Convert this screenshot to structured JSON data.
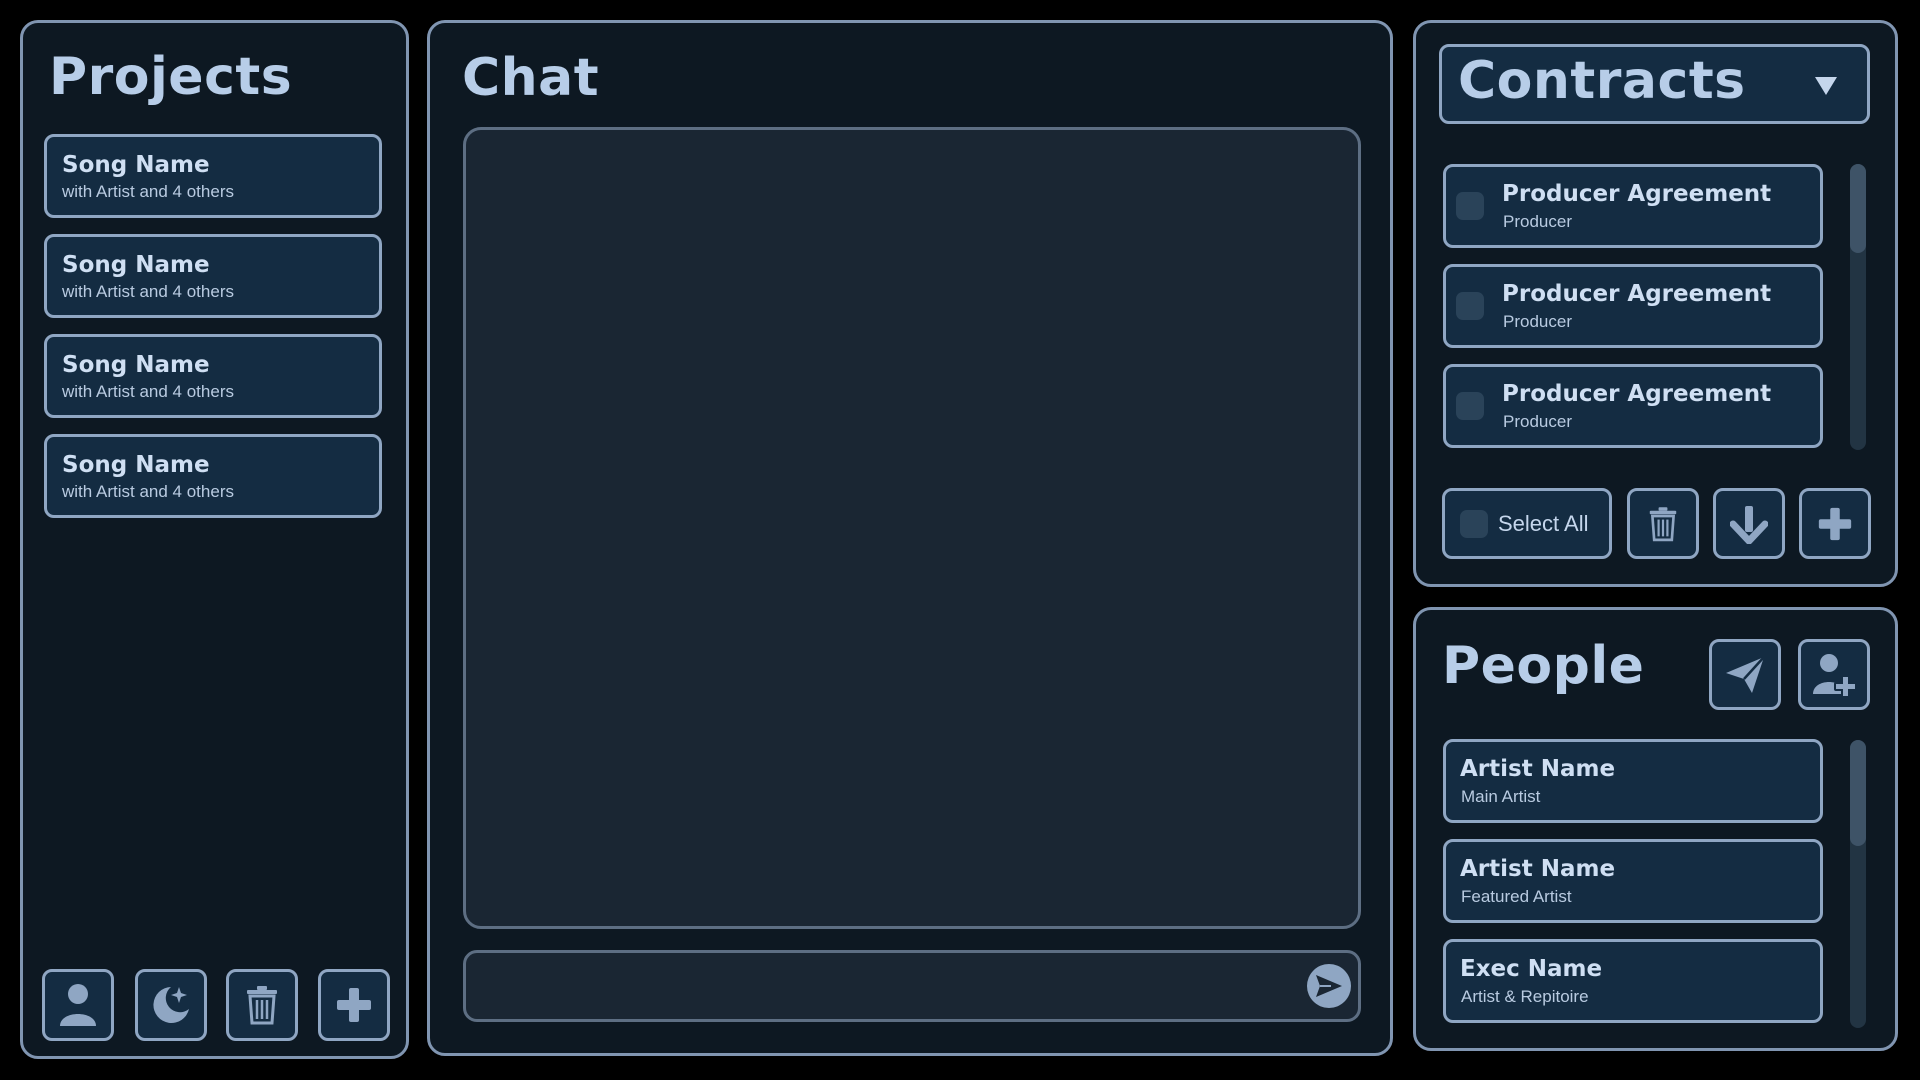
{
  "projects": {
    "title": "Projects",
    "items": [
      {
        "name": "Song Name",
        "subtitle": "with Artist and 4 others"
      },
      {
        "name": "Song Name",
        "subtitle": "with Artist and 4 others"
      },
      {
        "name": "Song Name",
        "subtitle": "with Artist and 4 others"
      },
      {
        "name": "Song Name",
        "subtitle": "with Artist and 4 others"
      }
    ],
    "toolbar_icons": [
      "person-icon",
      "moon-stars-icon",
      "trash-icon",
      "plus-icon"
    ]
  },
  "chat": {
    "title": "Chat",
    "message_input": {
      "value": "",
      "placeholder": ""
    },
    "send_icon": "send-icon"
  },
  "contracts": {
    "title": "Contracts",
    "dropdown_icon": "chevron-down-icon",
    "items": [
      {
        "name": "Producer Agreement",
        "role": "Producer",
        "checked": false
      },
      {
        "name": "Producer Agreement",
        "role": "Producer",
        "checked": false
      },
      {
        "name": "Producer Agreement",
        "role": "Producer",
        "checked": false
      }
    ],
    "select_all_label": "Select All",
    "action_icons": [
      "trash-icon",
      "download-arrow-icon",
      "plus-icon"
    ]
  },
  "people": {
    "title": "People",
    "header_icons": [
      "paper-plane-icon",
      "add-person-icon"
    ],
    "items": [
      {
        "name": "Artist Name",
        "role": "Main Artist"
      },
      {
        "name": "Artist Name",
        "role": "Featured Artist"
      },
      {
        "name": "Exec Name",
        "role": "Artist & Repitoire"
      }
    ]
  },
  "colors": {
    "background": "#000000",
    "panel": "#0d1822",
    "panel_border": "#8095b1",
    "card": "#142c42",
    "chat_area": "#1a2633",
    "text": "#c5d6ec"
  }
}
